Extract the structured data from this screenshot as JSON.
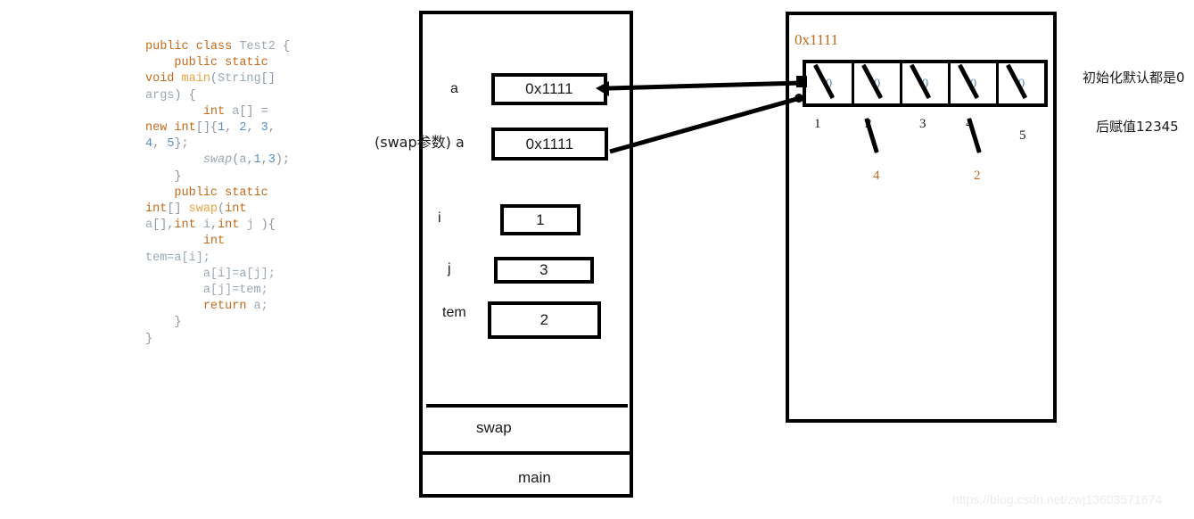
{
  "code": {
    "lines": [
      [
        {
          "t": "public class ",
          "c": "kw"
        },
        {
          "t": "Test2",
          "c": "id"
        },
        {
          "t": " {",
          "c": "pl"
        }
      ],
      [
        {
          "t": "    public static",
          "c": "kw"
        }
      ],
      [
        {
          "t": "void ",
          "c": "kw"
        },
        {
          "t": "main",
          "c": "fn"
        },
        {
          "t": "(",
          "c": "pl"
        },
        {
          "t": "String",
          "c": "id"
        },
        {
          "t": "[]",
          "c": "pl"
        }
      ],
      [
        {
          "t": "args",
          "c": "id"
        },
        {
          "t": ") {",
          "c": "pl"
        }
      ],
      [
        {
          "t": "        int ",
          "c": "kw"
        },
        {
          "t": "a",
          "c": "id"
        },
        {
          "t": "[] ",
          "c": "pl"
        },
        {
          "t": "=",
          "c": "pl"
        }
      ],
      [
        {
          "t": "new int",
          "c": "kw"
        },
        {
          "t": "[]",
          "c": "pl"
        },
        {
          "t": "{",
          "c": "pl"
        },
        {
          "t": "1",
          "c": "num"
        },
        {
          "t": ", ",
          "c": "pl"
        },
        {
          "t": "2",
          "c": "num"
        },
        {
          "t": ", ",
          "c": "pl"
        },
        {
          "t": "3",
          "c": "num"
        },
        {
          "t": ",",
          "c": "pl"
        }
      ],
      [
        {
          "t": "4",
          "c": "num"
        },
        {
          "t": ", ",
          "c": "pl"
        },
        {
          "t": "5",
          "c": "num"
        },
        {
          "t": "};",
          "c": "pl"
        }
      ],
      [
        {
          "t": "        ",
          "c": "pl"
        },
        {
          "t": "swap",
          "c": "fni"
        },
        {
          "t": "(",
          "c": "pl"
        },
        {
          "t": "a",
          "c": "id"
        },
        {
          "t": ",",
          "c": "pl"
        },
        {
          "t": "1",
          "c": "num"
        },
        {
          "t": ",",
          "c": "pl"
        },
        {
          "t": "3",
          "c": "num"
        },
        {
          "t": ");",
          "c": "pl"
        }
      ],
      [
        {
          "t": "    }",
          "c": "pl"
        }
      ],
      [
        {
          "t": "    public static",
          "c": "kw"
        }
      ],
      [
        {
          "t": "int",
          "c": "kw"
        },
        {
          "t": "[] ",
          "c": "pl"
        },
        {
          "t": "swap",
          "c": "fn"
        },
        {
          "t": "(",
          "c": "pl"
        },
        {
          "t": "int",
          "c": "kw"
        }
      ],
      [
        {
          "t": "a",
          "c": "id"
        },
        {
          "t": "[],",
          "c": "pl"
        },
        {
          "t": "int ",
          "c": "kw"
        },
        {
          "t": "i",
          "c": "id"
        },
        {
          "t": ",",
          "c": "pl"
        },
        {
          "t": "int ",
          "c": "kw"
        },
        {
          "t": "j ",
          "c": "id"
        },
        {
          "t": "){",
          "c": "pl"
        }
      ],
      [
        {
          "t": "        int",
          "c": "kw"
        }
      ],
      [
        {
          "t": "tem=a[i];",
          "c": "id"
        }
      ],
      [
        {
          "t": "        a[i]=a[j];",
          "c": "id"
        }
      ],
      [
        {
          "t": "        a[j]=tem;",
          "c": "id"
        }
      ],
      [
        {
          "t": "        return ",
          "c": "kw"
        },
        {
          "t": "a;",
          "c": "id"
        }
      ],
      [
        {
          "t": "    }",
          "c": "pl"
        }
      ],
      [
        {
          "t": "}",
          "c": "pl"
        }
      ]
    ]
  },
  "stack": {
    "variables": [
      {
        "name": "a",
        "value": "0x1111"
      },
      {
        "name": "(swap参数) a",
        "value": "0x1111"
      },
      {
        "name": "i",
        "value": "1"
      },
      {
        "name": "j",
        "value": "3"
      },
      {
        "name": "tem",
        "value": "2"
      }
    ],
    "frames": [
      {
        "label": "swap"
      },
      {
        "label": "main"
      }
    ]
  },
  "heap": {
    "address": "0x1111",
    "cells": [
      {
        "initial": "0"
      },
      {
        "initial": "0"
      },
      {
        "initial": "0"
      },
      {
        "initial": "0"
      },
      {
        "initial": "0"
      }
    ],
    "assigned_values": [
      {
        "value": "1",
        "struck": false,
        "replacement": ""
      },
      {
        "value": "2",
        "struck": true,
        "replacement": "4"
      },
      {
        "value": "3",
        "struck": false,
        "replacement": ""
      },
      {
        "value": "4",
        "struck": true,
        "replacement": "2"
      },
      {
        "value": "5",
        "struck": false,
        "replacement": ""
      }
    ]
  },
  "notes": {
    "init_note": "初始化默认都是0",
    "assign_note": "后赋值12345"
  },
  "watermark": "https://blog.csdn.net/zwj13603571674"
}
